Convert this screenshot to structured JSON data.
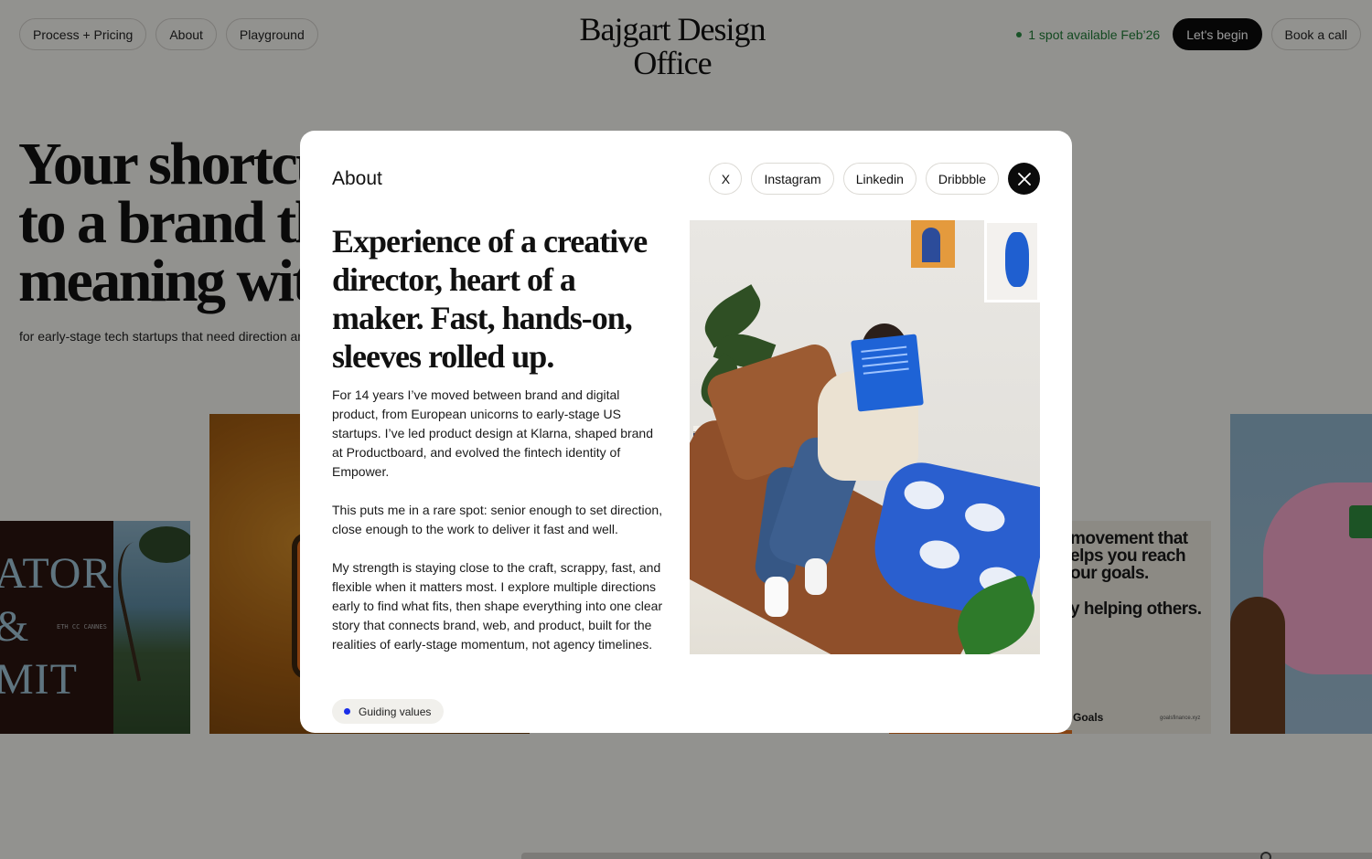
{
  "nav": {
    "left": [
      "Process + Pricing",
      "About",
      "Playground"
    ],
    "logo_line1": "Bajgart Design",
    "logo_line2": "Office",
    "availability": "1 spot available Feb’26",
    "cta_primary": "Let's begin",
    "cta_secondary": "Book a call"
  },
  "hero": {
    "line1": "Your shortcut",
    "line2": "to a brand that has",
    "line3": "meaning with",
    "subtitle": "for early-stage tech startups that need direction and"
  },
  "cards": {
    "eth_word1": "ATOR",
    "eth_word2": "&",
    "eth_word3": "MIT",
    "eth_small": "ETH CC CANNES",
    "goals_line1a": "movement that",
    "goals_line1b": "elps you reach",
    "goals_line1c": "our goals.",
    "goals_line2": "y helping others.",
    "goals_brand": "Goals",
    "goals_url": "goalsfinance.xyz"
  },
  "modal": {
    "title": "About",
    "socials": [
      "X",
      "Instagram",
      "Linkedin",
      "Dribbble"
    ],
    "close_icon": "close-icon",
    "headline": "Experience of a creative director, heart of a maker. Fast, hands-on,  sleeves rolled up.",
    "paragraphs": [
      "For 14 years I’ve moved between brand and digital product, from European unicorns to early-stage US startups. I’ve led product design at Klarna, shaped brand at Productboard, and evolved the fintech identity of Empower.",
      "This puts me in a rare spot: senior enough to set direction, close enough to the work to deliver it fast and well.",
      "My strength is staying close to the craft, scrappy, fast, and flexible when it matters most. I explore multiple directions early to find what fits, then shape everything into one clear story that connects brand, web, and product, built for the realities of early-stage momentum, not agency timelines."
    ],
    "guiding_label": "Guiding values",
    "accent_color": "#1a2ee8"
  },
  "colors": {
    "availability_green": "#1f7a36",
    "overlay": "rgba(0,0,0,0.40)"
  }
}
